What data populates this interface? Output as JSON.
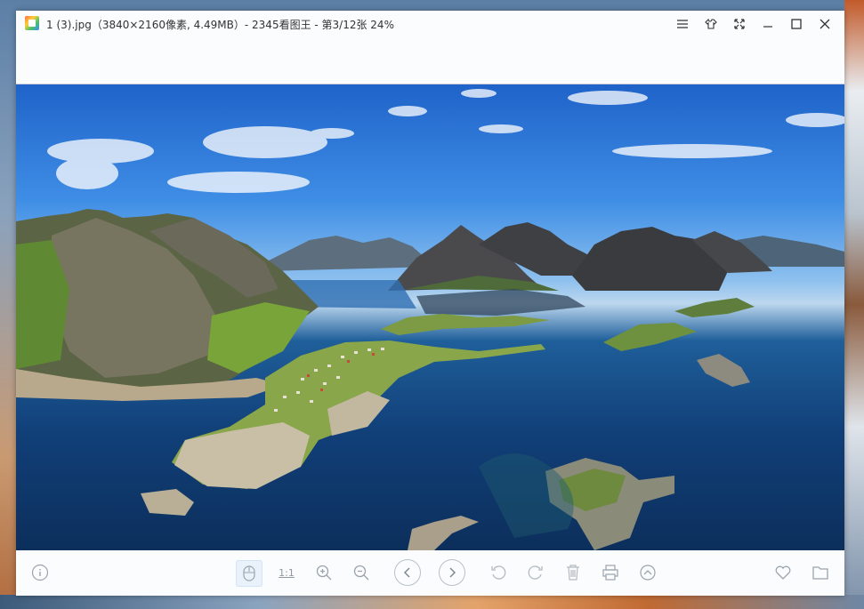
{
  "window": {
    "title": "1 (3).jpg（3840×2160像素, 4.49MB）- 2345看图王 - 第3/12张 24%",
    "controls": [
      "menu-icon",
      "skin-icon",
      "fullscreen-icon",
      "minimize-icon",
      "maximize-icon",
      "close-icon"
    ]
  },
  "toolbar": {
    "actual_size_label": "1:1",
    "buttons": [
      "info-icon",
      "mouse-mode-icon",
      "actual-size-button",
      "zoom-in-icon",
      "zoom-out-icon",
      "previous-icon",
      "next-icon",
      "rotate-left-icon",
      "rotate-right-icon",
      "delete-icon",
      "print-icon",
      "more-icon",
      "favorite-icon",
      "folder-icon"
    ]
  },
  "colors": {
    "window_bg": "#fafcfd",
    "icon_gray": "#9aa3ad",
    "active_bg": "#e9f1fb"
  }
}
